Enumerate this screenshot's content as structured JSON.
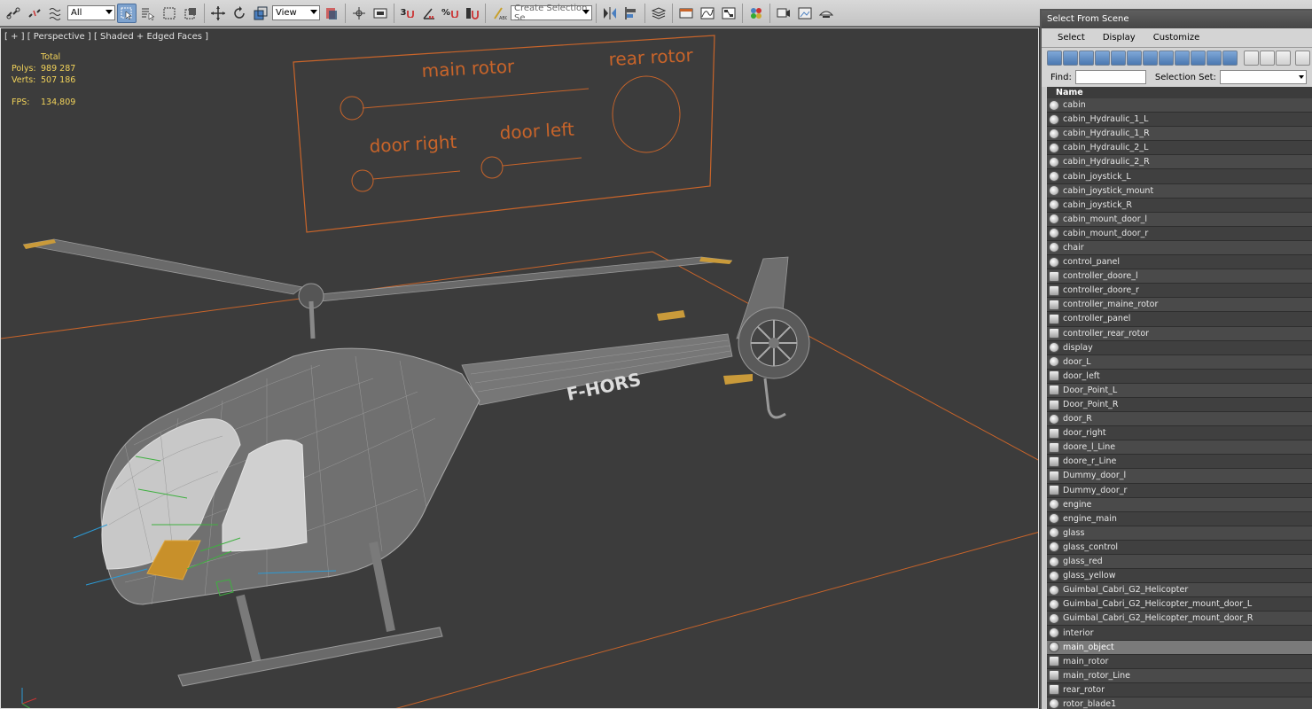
{
  "toolbar": {
    "filter_value": "All",
    "ref_coord_value": "View",
    "snap_3": "3",
    "snap_percent": "%",
    "selection_set_placeholder": "Create Selection Se"
  },
  "viewport": {
    "label": "[ + ] [ Perspective ] [ Shaded + Edged Faces ]",
    "stats": {
      "header": "Total",
      "polys_label": "Polys:",
      "polys_value": "989 287",
      "verts_label": "Verts:",
      "verts_value": "507 186",
      "fps_label": "FPS:",
      "fps_value": "134,809"
    },
    "panel_labels": {
      "main_rotor": "main rotor",
      "rear_rotor": "rear rotor",
      "door_right": "door right",
      "door_left": "door left"
    },
    "tail_registration": "F-HORS",
    "colors": {
      "wire_orange": "#c8642a",
      "stats_yellow": "#f2d35a",
      "mesh_grey": "#8a8a8a"
    }
  },
  "dialog": {
    "title": "Select From Scene",
    "menu": [
      "Select",
      "Display",
      "Customize"
    ],
    "find_label": "Find:",
    "selection_set_label": "Selection Set:",
    "column_header": "Name",
    "objects": [
      {
        "name": "cabin",
        "type": "geo"
      },
      {
        "name": "cabin_Hydraulic_1_L",
        "type": "geo"
      },
      {
        "name": "cabin_Hydraulic_1_R",
        "type": "geo"
      },
      {
        "name": "cabin_Hydraulic_2_L",
        "type": "geo"
      },
      {
        "name": "cabin_Hydraulic_2_R",
        "type": "geo"
      },
      {
        "name": "cabin_joystick_L",
        "type": "geo"
      },
      {
        "name": "cabin_joystick_mount",
        "type": "geo"
      },
      {
        "name": "cabin_joystick_R",
        "type": "geo"
      },
      {
        "name": "cabin_mount_door_l",
        "type": "geo"
      },
      {
        "name": "cabin_mount_door_r",
        "type": "geo"
      },
      {
        "name": "chair",
        "type": "geo"
      },
      {
        "name": "control_panel",
        "type": "geo"
      },
      {
        "name": "controller_doore_l",
        "type": "ctrl"
      },
      {
        "name": "controller_doore_r",
        "type": "ctrl"
      },
      {
        "name": "controller_maine_rotor",
        "type": "ctrl"
      },
      {
        "name": "controller_panel",
        "type": "ctrl"
      },
      {
        "name": "controller_rear_rotor",
        "type": "ctrl"
      },
      {
        "name": "display",
        "type": "geo"
      },
      {
        "name": "door_L",
        "type": "geo"
      },
      {
        "name": "door_left",
        "type": "ctrl"
      },
      {
        "name": "Door_Point_L",
        "type": "ctrl"
      },
      {
        "name": "Door_Point_R",
        "type": "ctrl"
      },
      {
        "name": "door_R",
        "type": "geo"
      },
      {
        "name": "door_right",
        "type": "ctrl"
      },
      {
        "name": "doore_l_Line",
        "type": "ctrl"
      },
      {
        "name": "doore_r_Line",
        "type": "ctrl"
      },
      {
        "name": "Dummy_door_l",
        "type": "ctrl"
      },
      {
        "name": "Dummy_door_r",
        "type": "ctrl"
      },
      {
        "name": "engine",
        "type": "geo"
      },
      {
        "name": "engine_main",
        "type": "geo"
      },
      {
        "name": "glass",
        "type": "geo"
      },
      {
        "name": "glass_control",
        "type": "geo"
      },
      {
        "name": "glass_red",
        "type": "geo"
      },
      {
        "name": "glass_yellow",
        "type": "geo"
      },
      {
        "name": "Guimbal_Cabri_G2_Helicopter",
        "type": "geo"
      },
      {
        "name": "Guimbal_Cabri_G2_Helicopter_mount_door_L",
        "type": "geo"
      },
      {
        "name": "Guimbal_Cabri_G2_Helicopter_mount_door_R",
        "type": "geo"
      },
      {
        "name": "interior",
        "type": "geo"
      },
      {
        "name": "main_object",
        "type": "geo",
        "selected": true
      },
      {
        "name": "main_rotor",
        "type": "ctrl"
      },
      {
        "name": "main_rotor_Line",
        "type": "ctrl"
      },
      {
        "name": "rear_rotor",
        "type": "ctrl"
      },
      {
        "name": "rotor_blade1",
        "type": "geo"
      }
    ]
  }
}
